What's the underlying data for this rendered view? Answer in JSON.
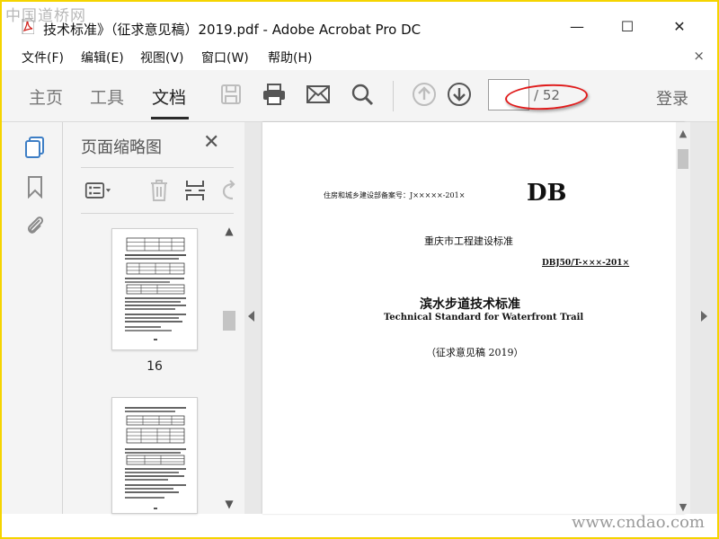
{
  "watermark": {
    "top": "中国道桥网",
    "bottom": "www.cndao.com"
  },
  "window": {
    "title": "技术标准》（征求意见稿）2019.pdf - Adobe Acrobat Pro DC",
    "controls": {
      "minimize": "—",
      "maximize": "☐",
      "close": "✕"
    }
  },
  "menu": {
    "items": [
      "文件(F)",
      "编辑(E)",
      "视图(V)",
      "窗口(W)",
      "帮助(H)"
    ],
    "close": "×"
  },
  "toolbar": {
    "tabs": [
      "主页",
      "工具",
      "文档"
    ],
    "active_tab": "文档",
    "page_current": "",
    "page_total": "/ 52",
    "login": "登录",
    "icons": [
      "save-icon",
      "print-icon",
      "email-icon",
      "search-icon",
      "prev-page-icon",
      "next-page-icon"
    ]
  },
  "thumbnails": {
    "title": "页面缩略图",
    "close": "✕",
    "pages": [
      {
        "label": "16"
      },
      {
        "label": ""
      }
    ]
  },
  "document": {
    "record_no": "住房和城乡建设部备案号：J×××××-201×",
    "db": "DB",
    "org": "重庆市工程建设标准",
    "code": "DBJ50/T-×××-201×",
    "title_zh": "滨水步道技术标准",
    "title_en": "Technical Standard for Waterfront Trail",
    "draft": "（征求意见稿 2019）"
  },
  "colors": {
    "accent": "#e01a1a",
    "frame": "#f5d400",
    "icon_gray": "#8a8a8a",
    "icon_active": "#3d7ec5"
  }
}
